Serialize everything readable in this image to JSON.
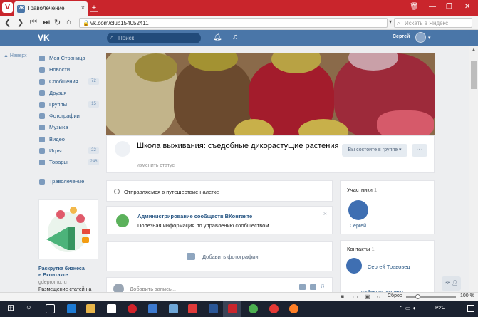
{
  "browser": {
    "logo": "V",
    "tab_title": "Траволечение",
    "tab_close": "×",
    "new_tab": "+",
    "url": "vk.com/club154052411",
    "search_placeholder": "Искать в Яндекс",
    "status_reset": "Сброс",
    "zoom": "100 %"
  },
  "vk_header": {
    "logo": "VK",
    "search_placeholder": "Поиск",
    "user_name": "Сергей"
  },
  "sidebar": {
    "back": "Наверх",
    "items": [
      {
        "label": "Моя Страница",
        "badge": ""
      },
      {
        "label": "Новости",
        "badge": ""
      },
      {
        "label": "Сообщения",
        "badge": "72"
      },
      {
        "label": "Друзья",
        "badge": ""
      },
      {
        "label": "Группы",
        "badge": "15"
      },
      {
        "label": "Фотографии",
        "badge": ""
      },
      {
        "label": "Музыка",
        "badge": ""
      },
      {
        "label": "Видео",
        "badge": ""
      },
      {
        "label": "Игры",
        "badge": "22"
      },
      {
        "label": "Товары",
        "badge": "246"
      }
    ],
    "group_link": "Траволечение",
    "ad": {
      "title": "Раскрутка бизнеса",
      "title2": "в Вконтакте",
      "domain": "gdepromo.ru",
      "text": "Размещение статей на"
    }
  },
  "group": {
    "name": "Школа выживания: съедобные дикорастущие растения",
    "status_action": "изменить статус",
    "member_button": "Вы состоите в группе",
    "more_button": "···"
  },
  "status_post": "Отправляемся в путешествие налегке",
  "admin_card": {
    "title": "Администрирование сообществ ВКонтакте",
    "desc": "Полезная информация по управлению сообществом",
    "close": "×"
  },
  "add_photos": "Добавить фотографии",
  "post_placeholder": "Добавить запись...",
  "members": {
    "title": "Участники",
    "count": "1",
    "name": "Сергей"
  },
  "contacts": {
    "title": "Контакты",
    "count": "1",
    "name": "Сергей Травовед",
    "add_link": "Добавить ссылку"
  },
  "chat_count": "38",
  "taskbar": {
    "lang": "РУС"
  }
}
